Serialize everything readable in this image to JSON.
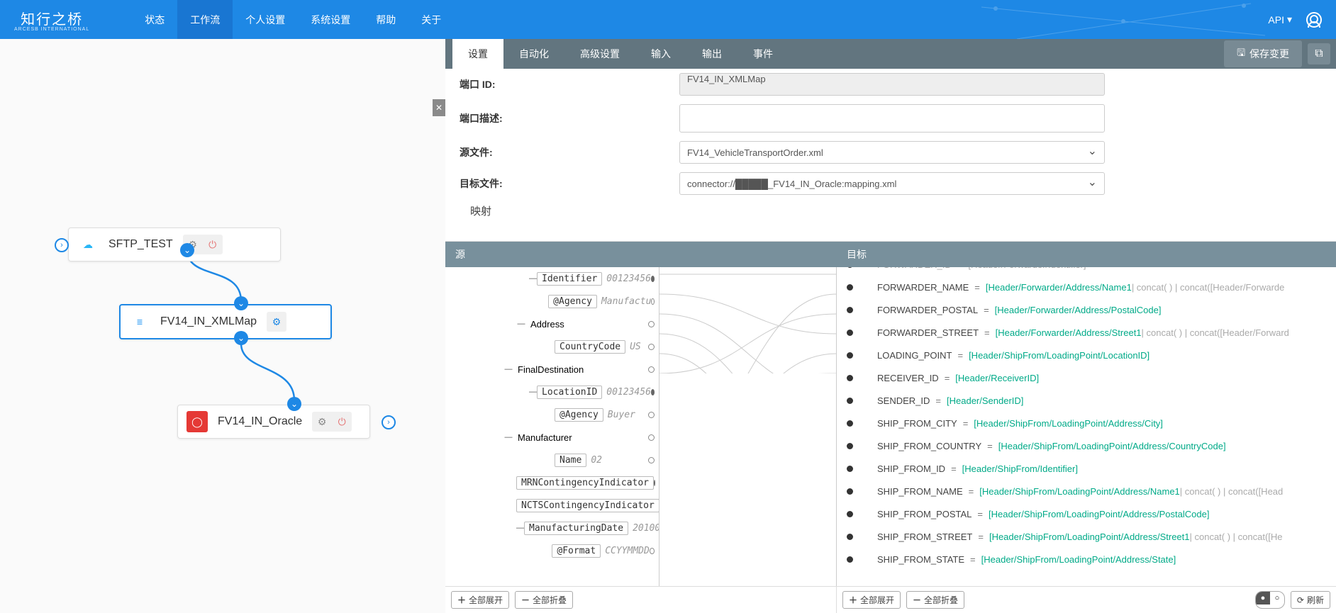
{
  "logo": {
    "main": "知行之桥",
    "sub": "ARCESB INTERNATIONAL"
  },
  "nav": {
    "items": [
      "状态",
      "工作流",
      "个人设置",
      "系统设置",
      "帮助",
      "关于"
    ],
    "active_index": 1,
    "api": "API"
  },
  "canvas": {
    "nodes": [
      {
        "id": "sftp",
        "label": "SFTP_TEST",
        "icon": "sftp"
      },
      {
        "id": "xmlmap",
        "label": "FV14_IN_XMLMap",
        "icon": "xml",
        "selected": true
      },
      {
        "id": "oracle",
        "label": "FV14_IN_Oracle",
        "icon": "oracle"
      }
    ]
  },
  "tabs": {
    "items": [
      "设置",
      "自动化",
      "高级设置",
      "输入",
      "输出",
      "事件"
    ],
    "active_index": 0,
    "save": "保存变更"
  },
  "form": {
    "port_id_label": "端口 ID:",
    "port_id_value": "FV14_IN_XMLMap",
    "port_desc_label": "端口描述:",
    "source_label": "源文件:",
    "source_value": "FV14_VehicleTransportOrder.xml",
    "target_label": "目标文件:",
    "target_value": "connector://█████_FV14_IN_Oracle:mapping.xml"
  },
  "mapping": {
    "title": "映射",
    "col_source": "源",
    "col_target": "目标",
    "expand_all": "全部展开",
    "collapse_all": "全部折叠",
    "refresh": "刷新",
    "source_tree": [
      {
        "indent": 118,
        "toggle": "—",
        "tag": "Identifier",
        "val": "00123456",
        "dot": "filled"
      },
      {
        "indent": 140,
        "toggle": "",
        "tag": "@Agency",
        "val": "Manufactu",
        "dot": "open"
      },
      {
        "indent": 100,
        "toggle": "—",
        "tag_plain": "Address",
        "dot": "open"
      },
      {
        "indent": 140,
        "toggle": "",
        "tag": "CountryCode",
        "val": "US",
        "dot": "open"
      },
      {
        "indent": 82,
        "toggle": "—",
        "tag_plain": "FinalDestination",
        "dot": "open"
      },
      {
        "indent": 118,
        "toggle": "—",
        "tag": "LocationID",
        "val": "00123456",
        "dot": "filled"
      },
      {
        "indent": 140,
        "toggle": "",
        "tag": "@Agency",
        "val": "Buyer",
        "dot": "open"
      },
      {
        "indent": 82,
        "toggle": "—",
        "tag_plain": "Manufacturer",
        "dot": "open"
      },
      {
        "indent": 140,
        "toggle": "",
        "tag": "Name",
        "val": "02",
        "dot": "open"
      },
      {
        "indent": 100,
        "toggle": "",
        "tag": "MRNContingencyIndicator",
        "dot": "filled"
      },
      {
        "indent": 100,
        "toggle": "",
        "tag": "NCTSContingencyIndicator",
        "dot": "filled"
      },
      {
        "indent": 100,
        "toggle": "—",
        "tag": "ManufacturingDate",
        "val": "20100",
        "dot": "open"
      },
      {
        "indent": 140,
        "toggle": "",
        "tag": "@Format",
        "val": "CCYYMMDD",
        "dot": "open"
      }
    ],
    "target_rows": [
      {
        "label": "FORWARDER_ID",
        "expr": "[Header/Forwarder/Identifier]",
        "muted": true
      },
      {
        "label": "FORWARDER_NAME",
        "expr": "[Header/Forwarder/Address/Name1",
        "tail": " | concat( ) | concat([Header/Forwarde"
      },
      {
        "label": "FORWARDER_POSTAL",
        "expr": "[Header/Forwarder/Address/PostalCode]"
      },
      {
        "label": "FORWARDER_STREET",
        "expr": "[Header/Forwarder/Address/Street1",
        "tail": " | concat( ) | concat([Header/Forward"
      },
      {
        "label": "LOADING_POINT",
        "expr": "[Header/ShipFrom/LoadingPoint/LocationID]"
      },
      {
        "label": "RECEIVER_ID",
        "expr": "[Header/ReceiverID]"
      },
      {
        "label": "SENDER_ID",
        "expr": "[Header/SenderID]"
      },
      {
        "label": "SHIP_FROM_CITY",
        "expr": "[Header/ShipFrom/LoadingPoint/Address/City]"
      },
      {
        "label": "SHIP_FROM_COUNTRY",
        "expr": "[Header/ShipFrom/LoadingPoint/Address/CountryCode]"
      },
      {
        "label": "SHIP_FROM_ID",
        "expr": "[Header/ShipFrom/Identifier]"
      },
      {
        "label": "SHIP_FROM_NAME",
        "expr": "[Header/ShipFrom/LoadingPoint/Address/Name1",
        "tail": " | concat( ) | concat([Head"
      },
      {
        "label": "SHIP_FROM_POSTAL",
        "expr": "[Header/ShipFrom/LoadingPoint/Address/PostalCode]"
      },
      {
        "label": "SHIP_FROM_STREET",
        "expr": "[Header/ShipFrom/LoadingPoint/Address/Street1",
        "tail": " | concat( ) | concat([He"
      },
      {
        "label": "SHIP_FROM_STATE",
        "expr": "[Header/ShipFrom/LoadingPoint/Address/State]"
      }
    ]
  }
}
